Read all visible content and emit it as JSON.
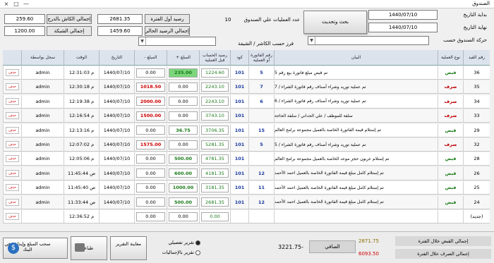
{
  "window": {
    "title": "الصندوق",
    "close": "×",
    "maximize": "□",
    "minimize": "—"
  },
  "filters": {
    "start_date_label": "بداية التاريخ",
    "start_date": "1440/07/10",
    "end_date_label": "نهاية التاريخ",
    "end_date": "1440/07/10",
    "move_label": "حركة الصندوق حسب",
    "search_button": "بحث وتحديث",
    "ops_count_label": "عدد العمليات علي الصندوق",
    "ops_count": "10",
    "sort_label": "فرز حسب الكاشر / الشيفة"
  },
  "summary": {
    "opening_label": "رصيد أول الفترة",
    "opening_value": "2681.35",
    "current_label": "إجمالي الرصيد الحالي",
    "current_value": "1459.60",
    "cashier_total_label": "إجمالي الكاش بالدرج",
    "cashier_total_value": "259.60",
    "network_total_label": "إجمالي الشبكة",
    "network_total_value": "1200.00"
  },
  "table": {
    "headers": {
      "id": "رقم القيد",
      "type": "نوع العملية",
      "desc": "البيان",
      "invoice": "رقم الفاتورة أو العملية",
      "code": "كود",
      "balance_before": "رصيد الحساب قبل العملية",
      "amount_plus": "المبلغ +",
      "amount_minus": "المبلغ -",
      "date": "التاريخ",
      "time": "الوقت",
      "user": "سجل بواسطة"
    },
    "rows": [
      {
        "id": "36",
        "type": "قبض",
        "desc": "تم قبض مبلغ فاتورة بيع رقم 5",
        "invoice": "5",
        "code": "101",
        "balance": "1224.60",
        "plus": "235.00",
        "minus": "0.00",
        "date": "1440/07/10",
        "time": "12:31:03 م",
        "user": "admin",
        "del": "حذف"
      },
      {
        "id": "35",
        "type": "صرف",
        "desc": "تم عملية توريد وشراء أصناف رقم فاتورة الشراء / 7",
        "invoice": "7",
        "code": "101",
        "balance": "2243.10",
        "plus": "0.00",
        "minus": "1018.50",
        "date": "1440/07/10",
        "time": "12:30:18 م",
        "user": "admin",
        "del": "حذف"
      },
      {
        "id": "34",
        "type": "صرف",
        "desc": "تم عملية توريد وشراء أصناف رقم فاتورة الشراء / 6",
        "invoice": "6",
        "code": "101",
        "balance": "2243.10",
        "plus": "0.00",
        "minus": "2000.00",
        "date": "1440/07/10",
        "time": "12:19:38 م",
        "user": "admin",
        "del": "حذف"
      },
      {
        "id": "33",
        "type": "صرف",
        "desc": "سلفة للموظف / علي الحداني / سلفة الحاجة",
        "invoice": "",
        "code": "101",
        "balance": "3743.10",
        "plus": "0.00",
        "minus": "1500.00",
        "date": "1440/07/10",
        "time": "12:16:54 م",
        "user": "admin",
        "del": "حذف"
      },
      {
        "id": "29",
        "type": "قبض",
        "desc": "تم إستلام قيمة الفاتورة الخاصة بالعميل مجموعة برامج العالم",
        "invoice": "15",
        "code": "101",
        "balance": "3706.35",
        "plus": "36.75",
        "minus": "0.00",
        "date": "1440/07/10",
        "time": "12:13:16 م",
        "user": "admin",
        "del": "حذف"
      },
      {
        "id": "32",
        "type": "صرف",
        "desc": "تم عملية توريد وشراء أصناف رقم فاتورة الشراء / 5",
        "invoice": "5",
        "code": "101",
        "balance": "5281.35",
        "plus": "0.00",
        "minus": "1575.00",
        "date": "1440/07/10",
        "time": "12:07:02 م",
        "user": "admin",
        "del": "حذف"
      },
      {
        "id": "28",
        "type": "قبض",
        "desc": "تم إستلام عربون حجز موعد الخاصة بالعميل مجموعة برامج العالم",
        "invoice": "",
        "code": "101",
        "balance": "4781.35",
        "plus": "500.00",
        "minus": "0.00",
        "date": "1440/07/10",
        "time": "12:05:06 م",
        "user": "admin",
        "del": "حذف"
      },
      {
        "id": "26",
        "type": "قبض",
        "desc": "تم إستلام كامل مبلغ قيمة الفاتورة الخاصة بالعميل احمد الأحمد",
        "invoice": "12",
        "code": "101",
        "balance": "4181.35",
        "plus": "600.00",
        "minus": "0.00",
        "date": "1440/07/10",
        "time": "11:45:44 ص",
        "user": "admin",
        "del": "حذف"
      },
      {
        "id": "25",
        "type": "قبض",
        "desc": "تم إستلام كامل مبلغ قيمة الفاتورة الخاصة بالعميل احمد الأحمد",
        "invoice": "11",
        "code": "101",
        "balance": "3181.35",
        "plus": "1000.00",
        "minus": "0.00",
        "date": "1440/07/10",
        "time": "11:45:40 ص",
        "user": "admin",
        "del": "حذف"
      },
      {
        "id": "24",
        "type": "قبض",
        "desc": "تم إستلام كامل مبلغ قيمة الفاتورة الخاصة بالعميل احمد الأحمد",
        "invoice": "12",
        "code": "101",
        "balance": "2681.35",
        "plus": "500.00",
        "minus": "0.00",
        "date": "1440/07/10",
        "time": "11:33:44 ص",
        "user": "admin",
        "del": "حذف"
      },
      {
        "id": "(جديد)",
        "type": "",
        "desc": "",
        "invoice": "",
        "code": "",
        "balance": "0.00",
        "plus": "0.00",
        "minus": "0.00",
        "date": "",
        "time": "12:36:52 م",
        "user": "",
        "del": "حذف"
      }
    ]
  },
  "footer": {
    "withdraw_button": "سحب المبلغ وإيداعه في البنك",
    "print_button": "طباعة",
    "preview_button": "معاينة التقرير",
    "radio_detail": "تقرير تفصيلي",
    "radio_totals": "تقرير بالإجماليات",
    "net_label": "الصافي",
    "net_value": "-3221.75",
    "receipts_label": "إجمالي القبض خلال الفترة",
    "receipts_value": "2871.75",
    "payments_label": "إجمالي الصرف خلال الفترة",
    "payments_value": "6093.50"
  },
  "colors": {
    "receipt": "#1a7a1a",
    "payment": "#c00000",
    "header_bg": "#dde3ec"
  }
}
